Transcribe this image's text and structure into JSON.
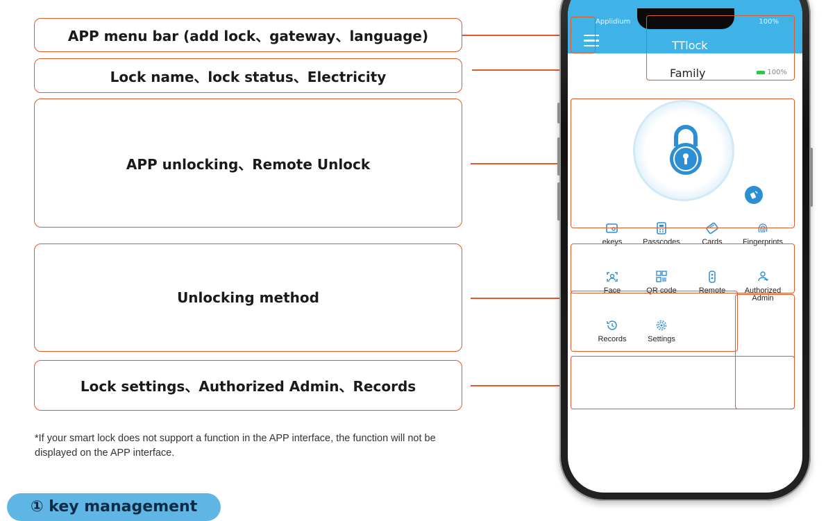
{
  "callouts": {
    "menu_bar": "APP menu bar (add lock、gateway、language)",
    "lock_info": "Lock name、lock status、Electricity",
    "unlocking": "APP unlocking、Remote Unlock",
    "unlock_method": "Unlocking method",
    "lock_settings": "Lock settings、Authorized Admin、Records"
  },
  "note": "*If your smart lock does not support a function in the APP interface, the function will not be displayed on the APP interface.",
  "section_label": "① key management",
  "phone": {
    "status_carrier": "Applidium",
    "status_battery": "100%",
    "app_title": "TTlock",
    "lock_name": "Family",
    "battery_text": "100%",
    "features": [
      {
        "label": "ekeys",
        "icon": "ekey-icon"
      },
      {
        "label": "Passcodes",
        "icon": "passcode-icon"
      },
      {
        "label": "Cards",
        "icon": "card-icon"
      },
      {
        "label": "Fingerprints",
        "icon": "fingerprint-icon"
      },
      {
        "label": "Face",
        "icon": "face-icon"
      },
      {
        "label": "QR code",
        "icon": "qr-code-icon"
      },
      {
        "label": "Remote",
        "icon": "remote-icon"
      },
      {
        "label": "Authorized Admin",
        "icon": "admin-icon"
      },
      {
        "label": "Records",
        "icon": "records-icon"
      },
      {
        "label": "Settings",
        "icon": "settings-icon"
      }
    ]
  },
  "colors": {
    "accent": "#e1592d",
    "header_blue": "#3fb3e8",
    "icon_blue": "#2d8fd3",
    "pill_blue": "#5fb5e3"
  }
}
